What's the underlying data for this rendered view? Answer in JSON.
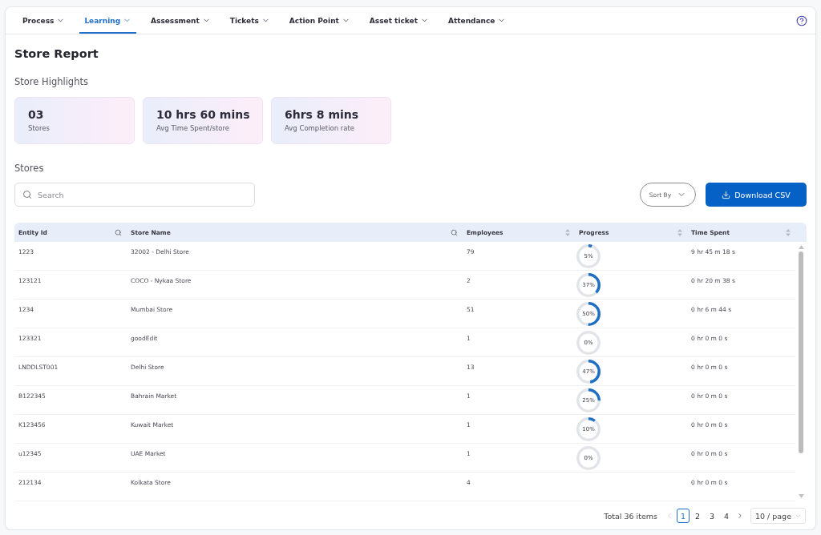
{
  "nav": {
    "tabs": [
      {
        "label": "Process",
        "selected": false
      },
      {
        "label": "Learning",
        "selected": true
      },
      {
        "label": "Assessment",
        "selected": false
      },
      {
        "label": "Tickets",
        "selected": false
      },
      {
        "label": "Action Point",
        "selected": false
      },
      {
        "label": "Asset ticket",
        "selected": false
      },
      {
        "label": "Attendance",
        "selected": false
      }
    ]
  },
  "page": {
    "title": "Store Report"
  },
  "highlights": {
    "heading": "Store Highlights",
    "cards": [
      {
        "value": "03",
        "label": "Stores"
      },
      {
        "value": "10 hrs 60 mins",
        "label": "Avg Time Spent/store"
      },
      {
        "value": "6hrs 8 mins",
        "label": "Avg Completion rate"
      }
    ]
  },
  "stores": {
    "heading": "Stores",
    "search": {
      "placeholder": "Search"
    },
    "sort_button": "Sort By",
    "download_button": "Download CSV"
  },
  "table": {
    "columns": [
      {
        "label": "Entity Id",
        "kind": "search"
      },
      {
        "label": "Store Name",
        "kind": "search"
      },
      {
        "label": "Employees",
        "kind": "sort"
      },
      {
        "label": "Progress",
        "kind": "sort"
      },
      {
        "label": "Time Spent",
        "kind": "sort"
      }
    ],
    "rows": [
      {
        "entity_id": "1223",
        "store_name": "32002 - Delhi Store",
        "employees": "79",
        "progress": "5%",
        "level": 0.05,
        "time_spent": "9 hr 45 m 18 s"
      },
      {
        "entity_id": "123121",
        "store_name": "COCO - Nykaa Store",
        "employees": "2",
        "progress": "37%",
        "level": 0.37,
        "time_spent": "0 hr 20 m 38 s"
      },
      {
        "entity_id": "1234",
        "store_name": "Mumbai Store",
        "employees": "51",
        "progress": "50%",
        "level": 0.5,
        "time_spent": "0 hr 6 m 44 s"
      },
      {
        "entity_id": "123321",
        "store_name": "goodEdit",
        "employees": "1",
        "progress": "0%",
        "level": 0,
        "time_spent": "0 hr 0 m 0 s"
      },
      {
        "entity_id": "LNDDLST001",
        "store_name": "Delhi Store",
        "employees": "13",
        "progress": "47%",
        "level": 0.47,
        "time_spent": "0 hr 0 m 0 s"
      },
      {
        "entity_id": "B122345",
        "store_name": "Bahrain Market",
        "employees": "1",
        "progress": "25%",
        "level": 0.25,
        "time_spent": "0 hr 0 m 0 s"
      },
      {
        "entity_id": "K123456",
        "store_name": "Kuwait Market",
        "employees": "1",
        "progress": "10%",
        "level": 0.1,
        "time_spent": "0 hr 0 m 0 s"
      },
      {
        "entity_id": "u12345",
        "store_name": "UAE Market",
        "employees": "1",
        "progress": "0%",
        "level": 0,
        "time_spent": "0 hr 0 m 0 s"
      },
      {
        "entity_id": "212134",
        "store_name": "Kolkata Store",
        "employees": "4",
        "time_spent": "0 hr 0 m 0 s"
      }
    ]
  },
  "pagination": {
    "total": "Total 36 items",
    "previous": {
      "disabled": true
    },
    "next": {
      "disabled": false
    },
    "pages": [
      {
        "label": "1",
        "selected": true
      },
      {
        "label": "2",
        "selected": false
      },
      {
        "label": "3",
        "selected": false
      },
      {
        "label": "4",
        "selected": false
      }
    ],
    "page_size": "10 / page"
  }
}
